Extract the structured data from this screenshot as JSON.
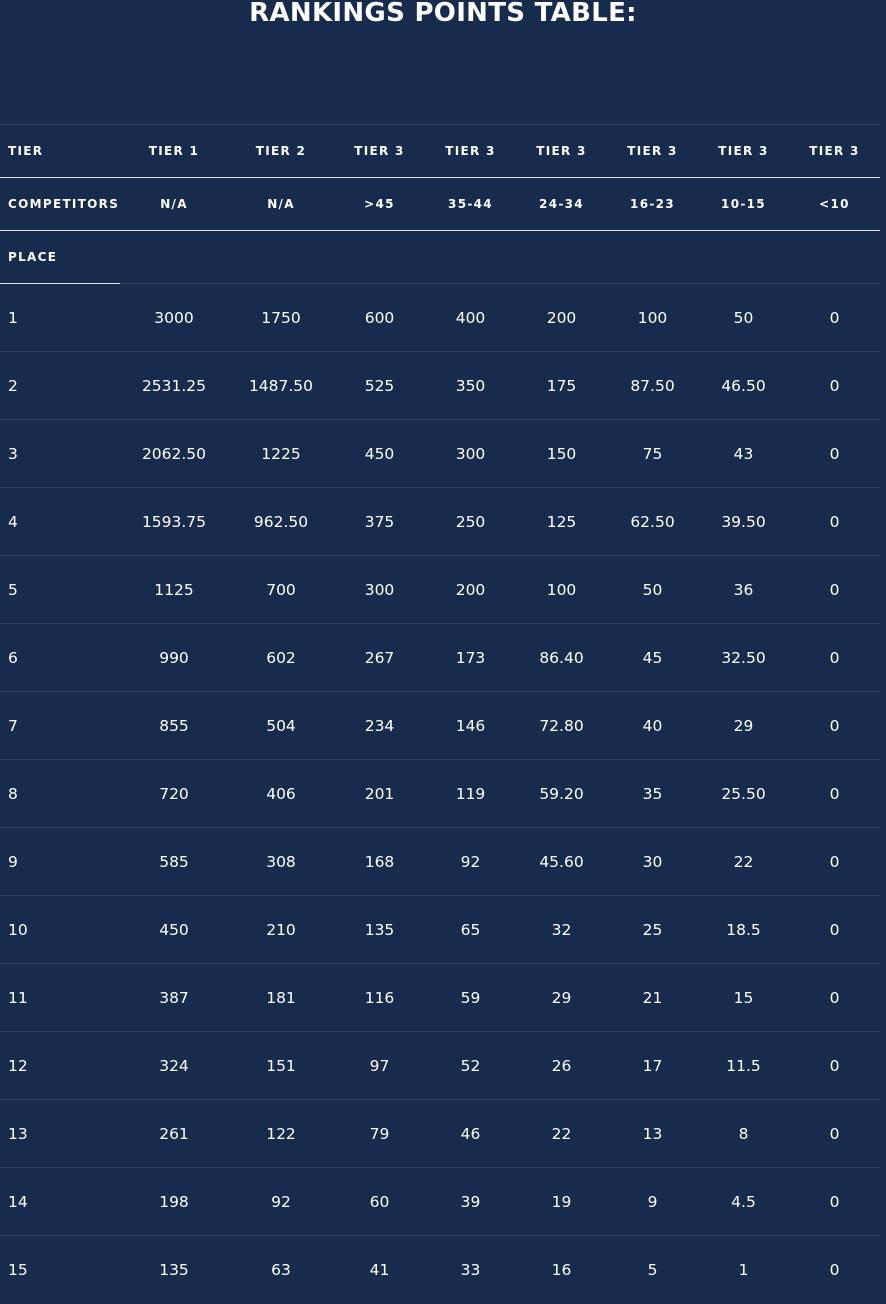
{
  "page": {
    "title": "RANKINGS POINTS TABLE:"
  },
  "table": {
    "tier_label": "TIER",
    "tiers": [
      "TIER 1",
      "TIER 2",
      "TIER 3",
      "TIER 3",
      "TIER 3",
      "TIER 3",
      "TIER 3",
      "TIER 3"
    ],
    "competitors_label": "COMPETITORS",
    "competitors": [
      "N/A",
      "N/A",
      ">45",
      "35-44",
      "24-34",
      "16-23",
      "10-15",
      "<10"
    ],
    "place_label": "PLACE",
    "rows": [
      {
        "place": "1",
        "values": [
          "3000",
          "1750",
          "600",
          "400",
          "200",
          "100",
          "50",
          "0"
        ]
      },
      {
        "place": "2",
        "values": [
          "2531.25",
          "1487.50",
          "525",
          "350",
          "175",
          "87.50",
          "46.50",
          "0"
        ]
      },
      {
        "place": "3",
        "values": [
          "2062.50",
          "1225",
          "450",
          "300",
          "150",
          "75",
          "43",
          "0"
        ]
      },
      {
        "place": "4",
        "values": [
          "1593.75",
          "962.50",
          "375",
          "250",
          "125",
          "62.50",
          "39.50",
          "0"
        ]
      },
      {
        "place": "5",
        "values": [
          "1125",
          "700",
          "300",
          "200",
          "100",
          "50",
          "36",
          "0"
        ]
      },
      {
        "place": "6",
        "values": [
          "990",
          "602",
          "267",
          "173",
          "86.40",
          "45",
          "32.50",
          "0"
        ]
      },
      {
        "place": "7",
        "values": [
          "855",
          "504",
          "234",
          "146",
          "72.80",
          "40",
          "29",
          "0"
        ]
      },
      {
        "place": "8",
        "values": [
          "720",
          "406",
          "201",
          "119",
          "59.20",
          "35",
          "25.50",
          "0"
        ]
      },
      {
        "place": "9",
        "values": [
          "585",
          "308",
          "168",
          "92",
          "45.60",
          "30",
          "22",
          "0"
        ]
      },
      {
        "place": "10",
        "values": [
          "450",
          "210",
          "135",
          "65",
          "32",
          "25",
          "18.5",
          "0"
        ]
      },
      {
        "place": "11",
        "values": [
          "387",
          "181",
          "116",
          "59",
          "29",
          "21",
          "15",
          "0"
        ]
      },
      {
        "place": "12",
        "values": [
          "324",
          "151",
          "97",
          "52",
          "26",
          "17",
          "11.5",
          "0"
        ]
      },
      {
        "place": "13",
        "values": [
          "261",
          "122",
          "79",
          "46",
          "22",
          "13",
          "8",
          "0"
        ]
      },
      {
        "place": "14",
        "values": [
          "198",
          "92",
          "60",
          "39",
          "19",
          "9",
          "4.5",
          "0"
        ]
      },
      {
        "place": "15",
        "values": [
          "135",
          "63",
          "41",
          "33",
          "16",
          "5",
          "1",
          "0"
        ]
      }
    ]
  },
  "colors": {
    "background": "#172b4d",
    "text": "#ffffff",
    "header_rule": "#e3e8f0",
    "row_rule": "#2c4168"
  }
}
